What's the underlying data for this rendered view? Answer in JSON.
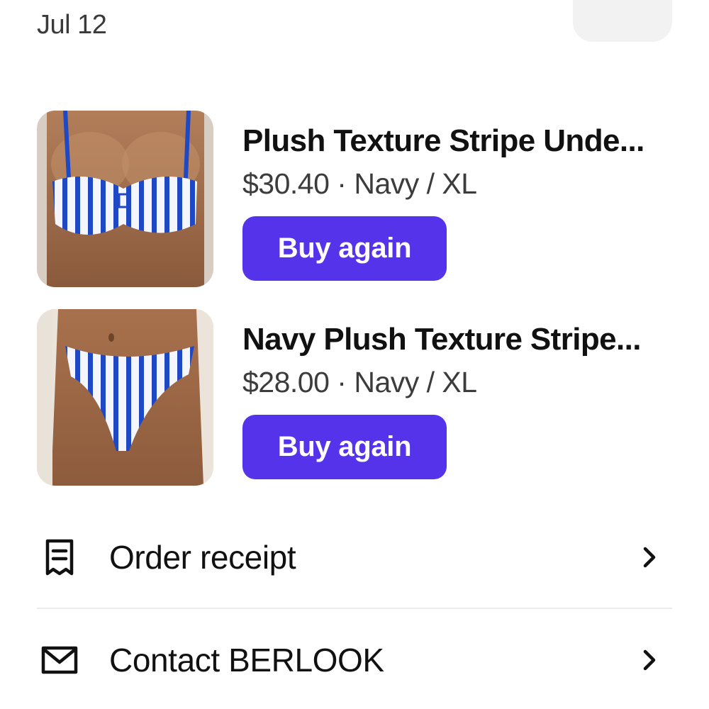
{
  "order": {
    "date": "Jul 12"
  },
  "items": [
    {
      "title": "Plush Texture Stripe Unde...",
      "meta": "$30.40 · Navy / XL",
      "buy_label": "Buy again",
      "image": "striped-bikini-top-photo"
    },
    {
      "title": "Navy Plush Texture Stripe...",
      "meta": "$28.00 · Navy / XL",
      "buy_label": "Buy again",
      "image": "striped-bikini-bottom-photo"
    }
  ],
  "actions": {
    "receipt": {
      "label": "Order receipt",
      "icon": "receipt-icon"
    },
    "contact": {
      "label": "Contact BERLOOK",
      "icon": "mail-icon"
    }
  },
  "colors": {
    "accent": "#5433eb",
    "stripe_blue": "#1f48c4"
  }
}
